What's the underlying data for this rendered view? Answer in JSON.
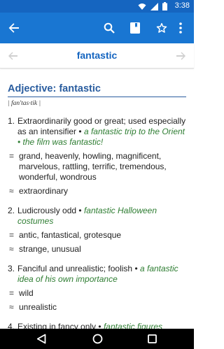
{
  "status": {
    "time": "3:38"
  },
  "word": "fantastic",
  "entry": {
    "heading": "Adjective: fantastic",
    "pronunciation": "| fan'tas·tik |",
    "senses": [
      {
        "num": "1.",
        "definition": "Extraordinarily good or great; used especially as an intensifier",
        "examples": "a fantastic trip to the Orient • the film was fantastic!",
        "synonyms": [
          {
            "mark": "=",
            "text": "grand, heavenly, howling, magnificent, marvelous, rattling, terrific, tremendous, wonderful, wondrous"
          },
          {
            "mark": "≈",
            "text": "extraordinary"
          }
        ]
      },
      {
        "num": "2.",
        "definition": "Ludicrously odd",
        "examples": "fantastic Halloween costumes",
        "synonyms": [
          {
            "mark": "=",
            "text": "antic, fantastical, grotesque"
          },
          {
            "mark": "≈",
            "text": "strange, unusual"
          }
        ]
      },
      {
        "num": "3.",
        "definition": "Fanciful and unrealistic; foolish",
        "examples": "a fantastic idea of his own importance",
        "synonyms": [
          {
            "mark": "=",
            "text": "wild"
          },
          {
            "mark": "≈",
            "text": "unrealistic"
          }
        ]
      },
      {
        "num": "4.",
        "definition": "Existing in fancy only",
        "examples": "fantastic figures",
        "synonyms": []
      }
    ]
  },
  "icons": {
    "status": [
      "wifi-icon",
      "signal-icon",
      "battery-icon"
    ],
    "app_bar": [
      "back-arrow-icon",
      "search-icon",
      "bookmark-icon",
      "star-icon",
      "more-vert-icon"
    ],
    "word_nav": [
      "prev-arrow-icon",
      "next-arrow-icon"
    ],
    "system_nav": [
      "back-triangle-icon",
      "home-circle-icon",
      "recents-square-icon"
    ]
  },
  "colors": {
    "status_bar": "#1565c0",
    "app_bar": "#1976d2",
    "word_title": "#1565c0",
    "heading": "#2a5d9f",
    "example": "#2e7d32"
  }
}
